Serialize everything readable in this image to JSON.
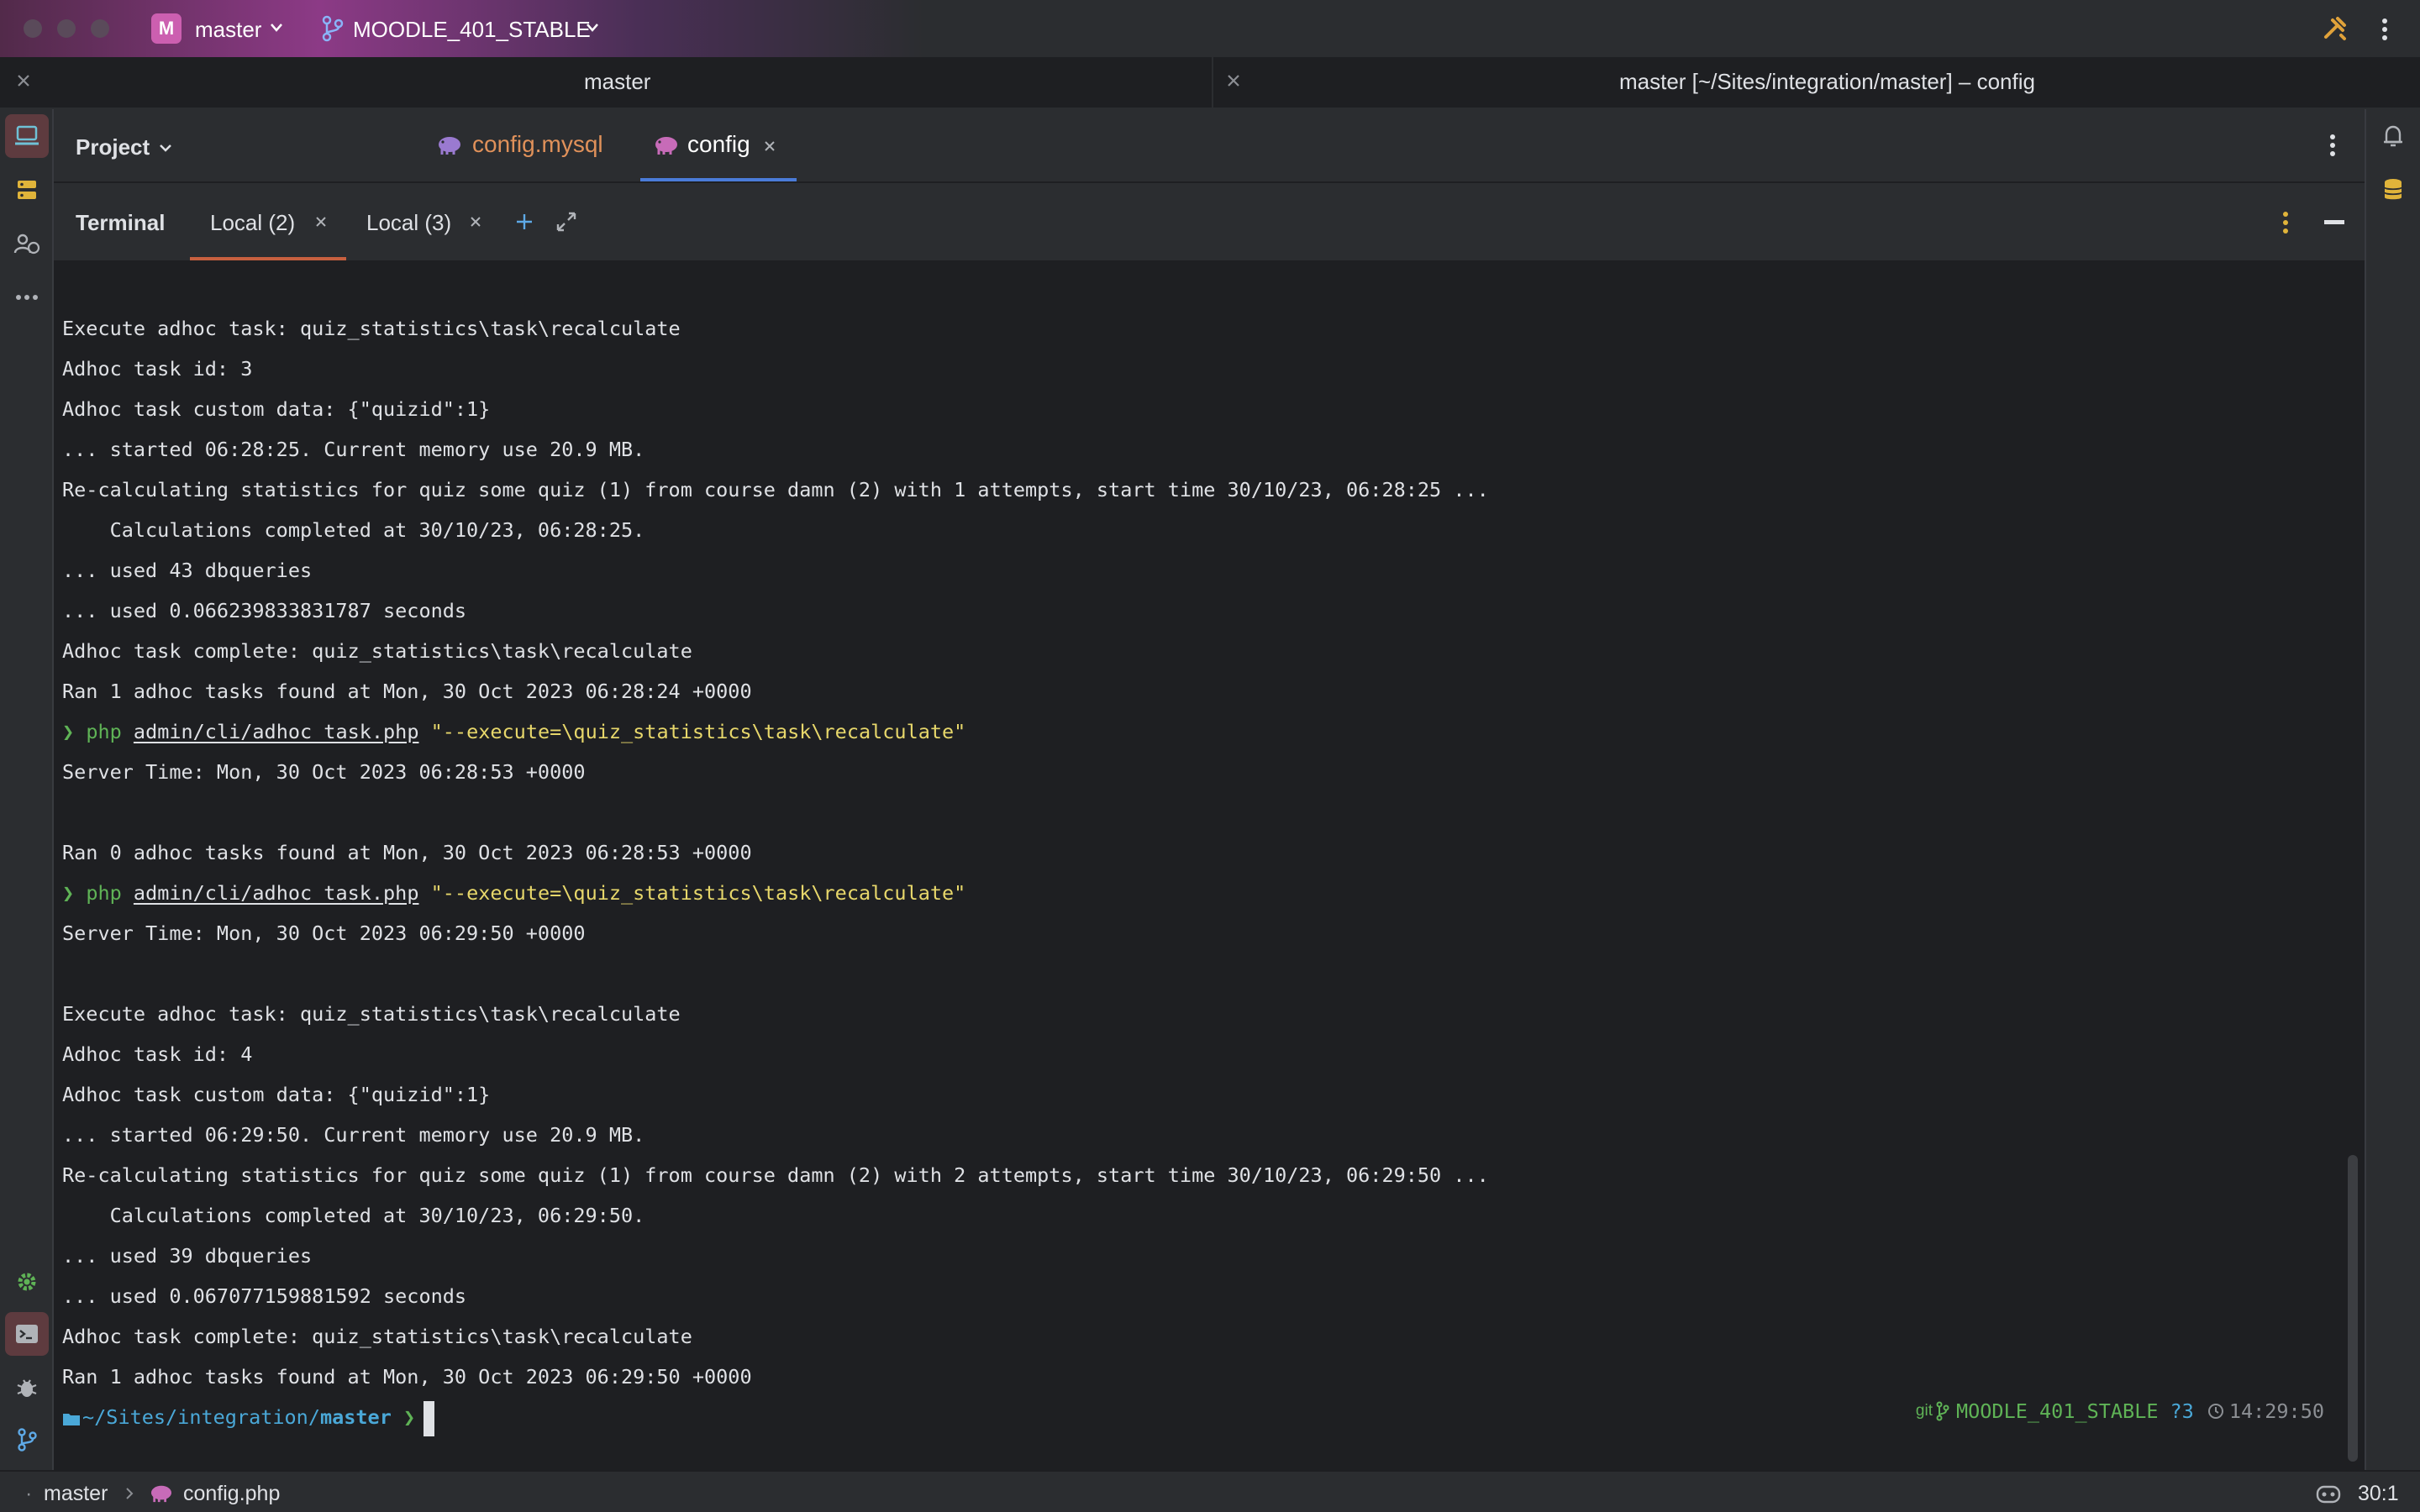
{
  "titlebar": {
    "project_initial": "M",
    "project_name": "master",
    "branch": "MOODLE_401_STABLE"
  },
  "window": {
    "left_title": "master",
    "right_title": "master [~/Sites/integration/master] – config"
  },
  "project_panel": {
    "label": "Project"
  },
  "editor_tabs": [
    {
      "label": "config.mysql",
      "active": false,
      "color": "#e0915a"
    },
    {
      "label": "config",
      "active": true,
      "color": "#ffffff"
    }
  ],
  "terminal": {
    "title": "Terminal",
    "tabs": [
      {
        "label": "Local (2)",
        "active": true
      },
      {
        "label": "Local (3)",
        "active": false
      }
    ],
    "lines": [
      "Execute adhoc task: quiz_statistics\\task\\recalculate",
      "Adhoc task id: 3",
      "Adhoc task custom data: {\"quizid\":1}",
      "... started 06:28:25. Current memory use 20.9 MB.",
      "Re-calculating statistics for quiz some quiz (1) from course damn (2) with 1 attempts, start time 30/10/23, 06:28:25 ...",
      "    Calculations completed at 30/10/23, 06:28:25.",
      "... used 43 dbqueries",
      "... used 0.066239833831787 seconds",
      "Adhoc task complete: quiz_statistics\\task\\recalculate",
      "Ran 1 adhoc tasks found at Mon, 30 Oct 2023 06:28:24 +0000",
      {
        "type": "command",
        "prompt": "❯",
        "cmd": "php",
        "path": "admin/cli/adhoc_task.php",
        "arg": "\"--execute=\\quiz_statistics\\task\\recalculate\""
      },
      "Server Time: Mon, 30 Oct 2023 06:28:53 +0000",
      "",
      "Ran 0 adhoc tasks found at Mon, 30 Oct 2023 06:28:53 +0000",
      {
        "type": "command",
        "prompt": "❯",
        "cmd": "php",
        "path": "admin/cli/adhoc_task.php",
        "arg": "\"--execute=\\quiz_statistics\\task\\recalculate\""
      },
      "Server Time: Mon, 30 Oct 2023 06:29:50 +0000",
      "",
      "Execute adhoc task: quiz_statistics\\task\\recalculate",
      "Adhoc task id: 4",
      "Adhoc task custom data: {\"quizid\":1}",
      "... started 06:29:50. Current memory use 20.9 MB.",
      "Re-calculating statistics for quiz some quiz (1) from course damn (2) with 2 attempts, start time 30/10/23, 06:29:50 ...",
      "    Calculations completed at 30/10/23, 06:29:50.",
      "... used 39 dbqueries",
      "... used 0.067077159881592 seconds",
      "Adhoc task complete: quiz_statistics\\task\\recalculate",
      "Ran 1 adhoc tasks found at Mon, 30 Oct 2023 06:29:50 +0000",
      {
        "type": "prompt",
        "cwd_prefix": "~/Sites/integration/",
        "cwd_name": "master",
        "prompt": "❯"
      }
    ],
    "right_prompt": {
      "git_label": "git",
      "branch": "MOODLE_401_STABLE",
      "status": "?3",
      "time": "14:29:50"
    }
  },
  "statusbar": {
    "breadcrumb_root": "master",
    "breadcrumb_file": "config.php",
    "position": "30:1"
  },
  "colors": {
    "prompt_green": "#5fb356",
    "string_yellow": "#e7d76b",
    "path_blue": "#4aa8d8",
    "accent_orange": "#c7603f",
    "accent_blue": "#4a7bd8"
  }
}
